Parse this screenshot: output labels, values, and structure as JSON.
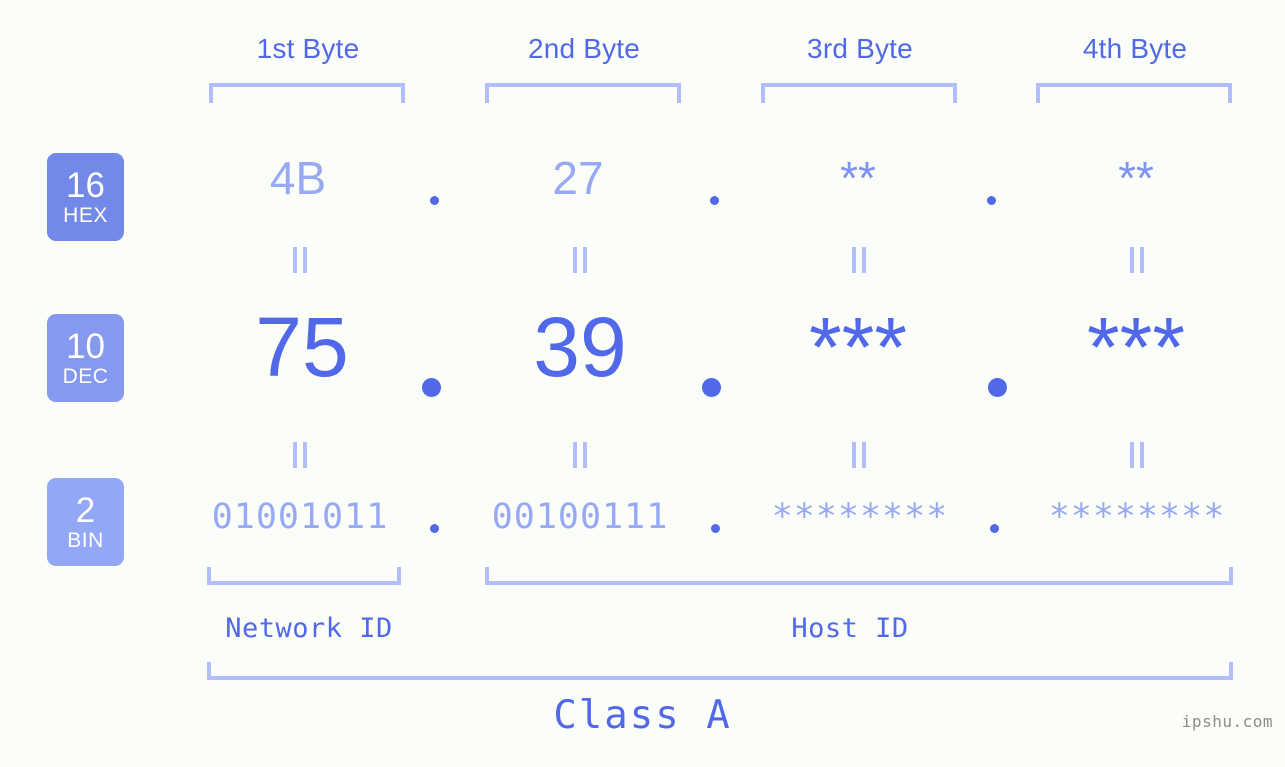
{
  "page": {
    "background": "#fbfdf9",
    "accent": "#5169e8",
    "accent_light": "#97a9f2",
    "bracket_color": "#b3bdf7",
    "watermark": "ipshu.com"
  },
  "byte_headers": [
    {
      "label": "1st Byte"
    },
    {
      "label": "2nd Byte"
    },
    {
      "label": "3rd Byte"
    },
    {
      "label": "4th Byte"
    }
  ],
  "radix_badges": [
    {
      "num": "16",
      "name": "HEX",
      "color": "#7289e8"
    },
    {
      "num": "10",
      "name": "DEC",
      "color": "#8599ee"
    },
    {
      "num": "2",
      "name": "BIN",
      "color": "#92a7f5"
    }
  ],
  "rows": {
    "hex": {
      "values": [
        "4B",
        "27",
        "**",
        "**"
      ],
      "separator": "."
    },
    "dec": {
      "values": [
        "75",
        "39",
        "***",
        "***"
      ],
      "separator": "."
    },
    "bin": {
      "values": [
        "01001011",
        "00100111",
        "********",
        "********"
      ],
      "separator": "."
    }
  },
  "equality_marks": {
    "glyph": "=",
    "count_per_gap": 4
  },
  "footer": {
    "network_id": "Network ID",
    "host_id": "Host ID",
    "class": "Class A"
  }
}
